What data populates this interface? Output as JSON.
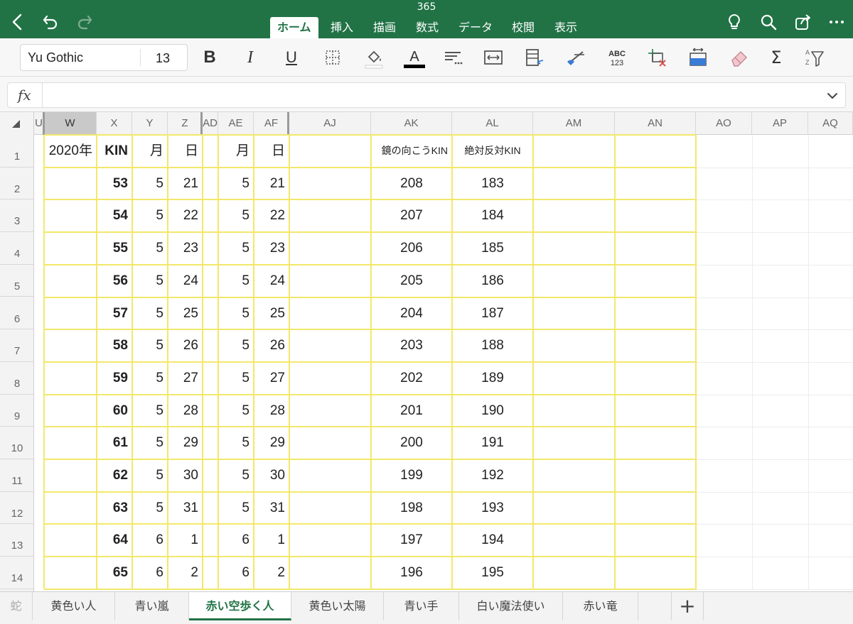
{
  "app": {
    "title": "365",
    "ribbon_tabs": [
      "ホーム",
      "挿入",
      "描画",
      "数式",
      "データ",
      "校閲",
      "表示"
    ],
    "active_tab": "ホーム",
    "accent_color": "#217346"
  },
  "toolbar": {
    "font_name": "Yu Gothic",
    "font_size": "13",
    "bold_label": "B",
    "italic_label": "I",
    "underline_label": "U",
    "font_color_label": "A",
    "abc_label": "ABC",
    "num_label": "123",
    "sum_label": "Σ",
    "icons": [
      "borders-icon",
      "fill-color-icon",
      "font-color-icon",
      "align-icon",
      "wrap-text-icon",
      "format-cells-icon",
      "clear-format-icon",
      "number-format-icon",
      "insert-delete-icon",
      "freeze-panes-icon",
      "eraser-icon",
      "autosum-icon",
      "sort-filter-icon"
    ]
  },
  "formula_bar": {
    "fx_label": "fx",
    "value": ""
  },
  "grid": {
    "columns": [
      "U",
      "W",
      "X",
      "Y",
      "Z",
      "AD",
      "AE",
      "AF",
      "AJ",
      "AK",
      "AL",
      "AM",
      "AN",
      "AO",
      "AP",
      "AQ"
    ],
    "selected_column": "W",
    "header_row": {
      "w": "2020年",
      "x": "KIN",
      "y": "月",
      "z": "日",
      "ae": "月",
      "af": "日",
      "ak": "鏡の向こうKIN",
      "al": "絶対反対KIN"
    },
    "rows": [
      {
        "num": "1"
      },
      {
        "num": "2",
        "kin": "53",
        "m1": "5",
        "d1": "21",
        "m2": "5",
        "d2": "21",
        "mirror": "208",
        "opposite": "183"
      },
      {
        "num": "3",
        "kin": "54",
        "m1": "5",
        "d1": "22",
        "m2": "5",
        "d2": "22",
        "mirror": "207",
        "opposite": "184"
      },
      {
        "num": "4",
        "kin": "55",
        "m1": "5",
        "d1": "23",
        "m2": "5",
        "d2": "23",
        "mirror": "206",
        "opposite": "185"
      },
      {
        "num": "5",
        "kin": "56",
        "m1": "5",
        "d1": "24",
        "m2": "5",
        "d2": "24",
        "mirror": "205",
        "opposite": "186"
      },
      {
        "num": "6",
        "kin": "57",
        "m1": "5",
        "d1": "25",
        "m2": "5",
        "d2": "25",
        "mirror": "204",
        "opposite": "187"
      },
      {
        "num": "7",
        "kin": "58",
        "m1": "5",
        "d1": "26",
        "m2": "5",
        "d2": "26",
        "mirror": "203",
        "opposite": "188"
      },
      {
        "num": "8",
        "kin": "59",
        "m1": "5",
        "d1": "27",
        "m2": "5",
        "d2": "27",
        "mirror": "202",
        "opposite": "189"
      },
      {
        "num": "9",
        "kin": "60",
        "m1": "5",
        "d1": "28",
        "m2": "5",
        "d2": "28",
        "mirror": "201",
        "opposite": "190"
      },
      {
        "num": "10",
        "kin": "61",
        "m1": "5",
        "d1": "29",
        "m2": "5",
        "d2": "29",
        "mirror": "200",
        "opposite": "191"
      },
      {
        "num": "11",
        "kin": "62",
        "m1": "5",
        "d1": "30",
        "m2": "5",
        "d2": "30",
        "mirror": "199",
        "opposite": "192"
      },
      {
        "num": "12",
        "kin": "63",
        "m1": "5",
        "d1": "31",
        "m2": "5",
        "d2": "31",
        "mirror": "198",
        "opposite": "193"
      },
      {
        "num": "13",
        "kin": "64",
        "m1": "6",
        "d1": "1",
        "m2": "6",
        "d2": "1",
        "mirror": "197",
        "opposite": "194"
      },
      {
        "num": "14",
        "kin": "65",
        "m1": "6",
        "d1": "2",
        "m2": "6",
        "d2": "2",
        "mirror": "196",
        "opposite": "195"
      }
    ],
    "border_color": "#f3e86a"
  },
  "sheet_tabs": {
    "partial_left": "蛇",
    "tabs": [
      "黄色い人",
      "青い嵐",
      "赤い空歩く人",
      "黄色い太陽",
      "青い手",
      "白い魔法使い",
      "赤い竜"
    ],
    "active": "赤い空歩く人",
    "add_label": "+"
  }
}
